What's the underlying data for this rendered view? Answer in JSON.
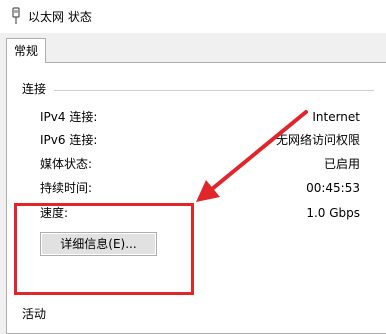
{
  "window": {
    "title": "以太网 状态",
    "title_icon": "network-adapter-icon"
  },
  "tabs": [
    {
      "label": "常规"
    }
  ],
  "connection": {
    "section_label": "连接",
    "rows": [
      {
        "label": "IPv4 连接:",
        "value": "Internet"
      },
      {
        "label": "IPv6 连接:",
        "value": "无网络访问权限"
      },
      {
        "label": "媒体状态:",
        "value": "已启用"
      },
      {
        "label": "持续时间:",
        "value": "00:45:53"
      },
      {
        "label": "速度:",
        "value": "1.0 Gbps"
      }
    ],
    "details_button": "详细信息(E)..."
  },
  "next_section_partial": "活动",
  "annotation": {
    "color": "#e0262a"
  }
}
